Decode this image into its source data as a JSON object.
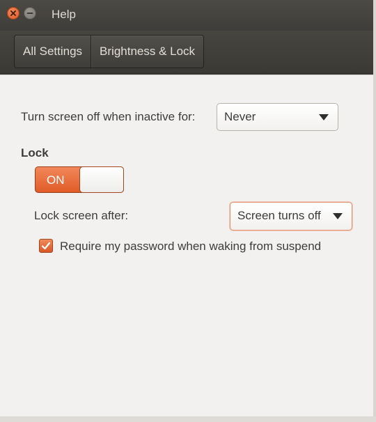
{
  "window": {
    "title": "Help"
  },
  "toolbar": {
    "crumbs": [
      {
        "label": "All Settings"
      },
      {
        "label": "Brightness & Lock"
      }
    ]
  },
  "brightness": {
    "screen_off_label": "Turn screen off when inactive for:",
    "screen_off_value": "Never"
  },
  "lock": {
    "section_title": "Lock",
    "switch_label": "ON",
    "switch_state": "on",
    "lock_after_label": "Lock screen after:",
    "lock_after_value": "Screen turns off",
    "require_password_label": "Require my password when waking from suspend",
    "require_password_checked": true
  },
  "colors": {
    "accent": "#e95420",
    "titlebar": "#3e3d39",
    "content_bg": "#f2f1ef"
  },
  "icons": {
    "close": "close-icon",
    "minimize": "minimize-icon",
    "dropdown": "triangle-down-icon",
    "check": "check-icon"
  }
}
